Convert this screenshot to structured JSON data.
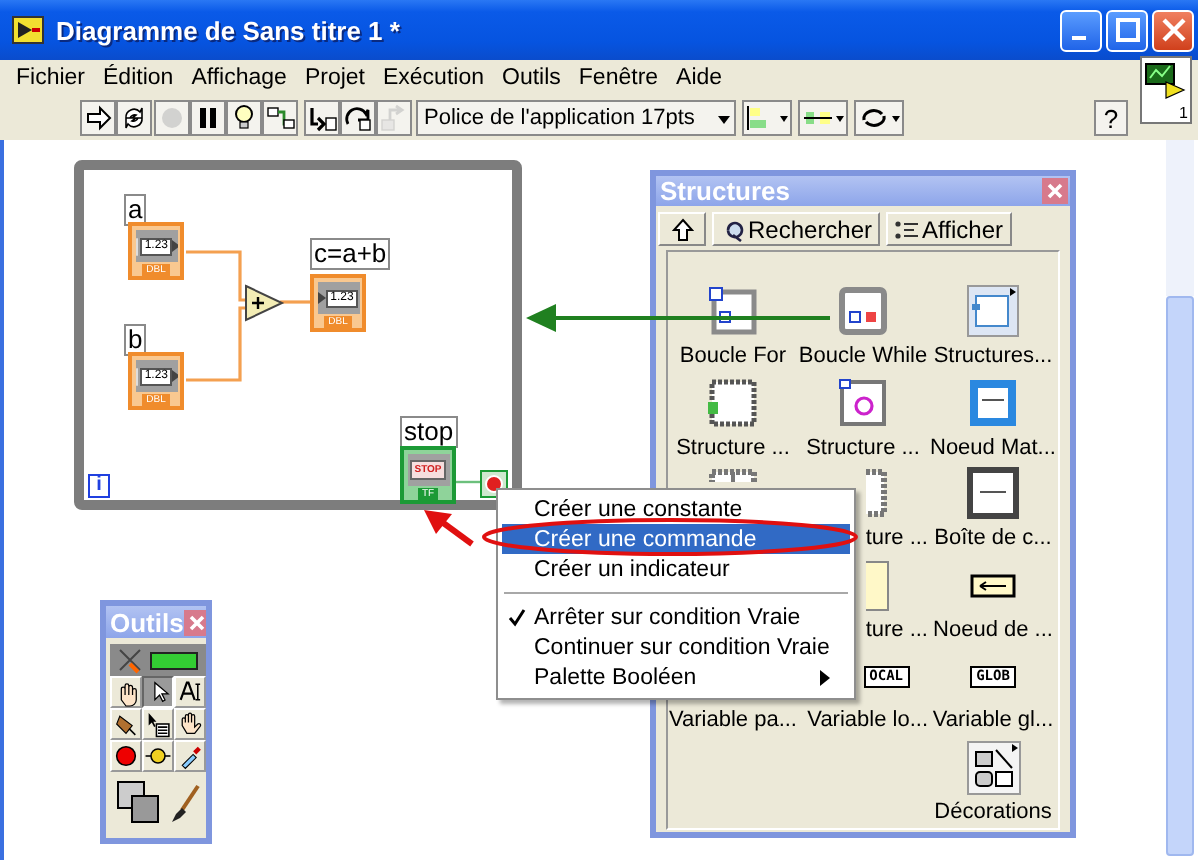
{
  "window": {
    "title": "Diagramme de Sans titre 1 *"
  },
  "menu": [
    {
      "label": "Fichier"
    },
    {
      "label": "Édition"
    },
    {
      "label": "Affichage"
    },
    {
      "label": "Projet"
    },
    {
      "label": "Exécution"
    },
    {
      "label": "Outils"
    },
    {
      "label": "Fenêtre"
    },
    {
      "label": "Aide"
    }
  ],
  "toolbar": {
    "buttons": [
      {
        "disabled": false
      },
      {
        "disabled": false
      },
      {
        "disabled": true
      },
      {
        "disabled": false
      },
      {
        "disabled": false
      },
      {
        "disabled": false
      },
      {
        "disabled": false
      },
      {
        "disabled": false
      },
      {
        "disabled": true
      }
    ],
    "font": "Police de l'application 17pts",
    "help": "?"
  },
  "vi_icon": {
    "number": "1"
  },
  "diagram": {
    "controls": [
      {
        "label": "a",
        "display": "1.23",
        "type": "DBL"
      },
      {
        "label": "b",
        "display": "1.23",
        "type": "DBL"
      }
    ],
    "indicator": {
      "label": "c=a+b",
      "display": "1.23",
      "type": "DBL"
    },
    "stop": {
      "label": "stop",
      "button": "STOP",
      "type": "TF"
    },
    "iteration": "i"
  },
  "structures_palette": {
    "title": "Structures",
    "buttons": [
      "Rechercher",
      "Afficher"
    ],
    "rows": [
      [
        {
          "kind": "full",
          "label": "Boucle For"
        },
        {
          "kind": "full",
          "label": "Boucle While"
        },
        {
          "kind": "full",
          "label": "Structures..."
        }
      ],
      [
        {
          "kind": "full",
          "label": "Structure ..."
        },
        {
          "kind": "full",
          "label": "Structure ..."
        },
        {
          "kind": "full",
          "label": "Noeud Mat..."
        }
      ],
      [
        {
          "kind": "no-label"
        },
        {
          "kind": "cut",
          "label": "ture ..."
        },
        {
          "kind": "full",
          "label": "Boîte de c..."
        }
      ],
      [
        null,
        {
          "kind": "cut",
          "label": "ture ..."
        },
        {
          "kind": "full",
          "label": "Noeud de ..."
        }
      ],
      [
        {
          "kind": "no-icon",
          "label": "Variable pa..."
        },
        {
          "kind": "cut",
          "label": "Variable lo...",
          "icon_text": "OCAL"
        },
        {
          "kind": "full",
          "label": "Variable gl...",
          "icon_text": "GLOB"
        }
      ],
      [
        null,
        null,
        {
          "kind": "full",
          "label": "Décorations"
        }
      ]
    ]
  },
  "context_menu": {
    "items": [
      {
        "kind": "item",
        "label": "Créer une constante",
        "selected": false,
        "checked": false
      },
      {
        "kind": "item",
        "label": "Créer une commande",
        "selected": true,
        "checked": false
      },
      {
        "kind": "item",
        "label": "Créer un indicateur",
        "selected": false,
        "checked": false
      },
      {
        "kind": "separator"
      },
      {
        "kind": "item",
        "label": "Arrêter sur condition Vraie",
        "selected": false,
        "checked": true
      },
      {
        "kind": "item",
        "label": "Continuer sur condition Vraie",
        "selected": false,
        "checked": false
      },
      {
        "kind": "submenu",
        "label": "Palette Booléen",
        "selected": false,
        "checked": false
      }
    ]
  },
  "tools_palette": {
    "title": "Outils"
  }
}
